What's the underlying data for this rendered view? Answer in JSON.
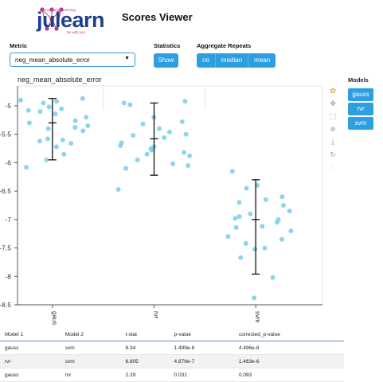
{
  "header": {
    "logo_text": "julearn",
    "logo_tag_top": "we love preprocessing",
    "logo_tag_bottom": "be with you",
    "title": "Scores Viewer"
  },
  "controls": {
    "metric_label": "Metric",
    "metric_value": "neg_mean_absolute_error",
    "statistics_label": "Statistics",
    "show_label": "Show",
    "aggregate_label": "Aggregate Repeats",
    "aggregate_options": [
      "no",
      "median",
      "mean"
    ]
  },
  "models_panel": {
    "label": "Models",
    "items": [
      "gauss",
      "rvr",
      "svm"
    ]
  },
  "colors": {
    "accent": "#2d9fe0",
    "point": "#7fd0ea",
    "errorbar": "#111111"
  },
  "toolbar_icons": [
    "bokeh-logo-icon",
    "pan-icon",
    "box-zoom-icon",
    "wheel-zoom-icon",
    "save-icon",
    "reset-icon",
    "hover-icon"
  ],
  "chart_data": {
    "type": "scatter",
    "title": "neg_mean_absolute_error",
    "categories": [
      "gauss",
      "rvr",
      "svm"
    ],
    "ylim": [
      -8.5,
      -4.65
    ],
    "yticks": [
      -5,
      -5.5,
      -6,
      -6.5,
      -7,
      -7.5,
      -8,
      -8.5
    ],
    "ytick_labels": [
      "-5",
      "-5.5",
      "-6",
      "-6.5",
      "-7",
      "-7.5",
      "-8",
      "-8.5"
    ],
    "series": [
      {
        "name": "gauss",
        "points": [
          -4.87,
          -4.9,
          -4.92,
          -4.95,
          -5.02,
          -5.05,
          -5.08,
          -5.1,
          -5.14,
          -5.2,
          -5.26,
          -5.3,
          -5.35,
          -5.38,
          -5.4,
          -5.44,
          -5.58,
          -5.6,
          -5.62,
          -5.66,
          -5.72,
          -5.85,
          -5.95,
          -6.08
        ],
        "mean": -5.3,
        "err_low": -5.95,
        "err_high": -4.87
      },
      {
        "name": "rvr",
        "points": [
          -4.92,
          -4.95,
          -4.98,
          -5.2,
          -5.28,
          -5.32,
          -5.4,
          -5.46,
          -5.5,
          -5.52,
          -5.56,
          -5.65,
          -5.7,
          -5.72,
          -5.75,
          -5.78,
          -5.82,
          -5.85,
          -5.88,
          -5.95,
          -6.02,
          -6.05,
          -6.1,
          -6.47
        ],
        "mean": -5.58,
        "err_low": -6.22,
        "err_high": -4.95
      },
      {
        "name": "svm",
        "points": [
          -6.15,
          -6.4,
          -6.45,
          -6.6,
          -6.65,
          -6.7,
          -6.75,
          -6.85,
          -6.9,
          -6.95,
          -6.98,
          -7.0,
          -7.05,
          -7.12,
          -7.14,
          -7.2,
          -7.3,
          -7.35,
          -7.42,
          -7.5,
          -7.52,
          -7.67,
          -8.02,
          -8.38
        ],
        "mean": -7.0,
        "err_low": -7.96,
        "err_high": -6.3
      }
    ]
  },
  "stats_table": {
    "headers": [
      "Model 1",
      "Model 2",
      "t-stat",
      "p-value",
      "corrected_p-value"
    ],
    "rows": [
      [
        "gauss",
        "svm",
        "8.34",
        "1.499e-8",
        "4.496e-8"
      ],
      [
        "rvr",
        "svm",
        "6.805",
        "4.876e-7",
        "1.463e-6"
      ],
      [
        "gauss",
        "rvr",
        "2.29",
        "0.031",
        "0.093"
      ]
    ]
  }
}
